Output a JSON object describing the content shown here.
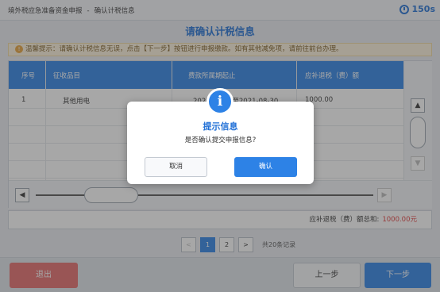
{
  "header": {
    "breadcrumb_parent": "境外税应急准备资金申报",
    "breadcrumb_sep": "-",
    "breadcrumb_current": "确认计税信息",
    "timer": "150s"
  },
  "page_title": "请确认计税信息",
  "notice": {
    "text": "温馨提示：请确认计税信息无误，点击【下一步】按钮进行申报缴款。如有其他减免项，请前往前台办理。"
  },
  "table": {
    "columns": [
      "序号",
      "征收品目",
      "费款所属期起止",
      "应补退税（费）额"
    ],
    "rows": [
      [
        "1",
        "其他用电",
        "2021-08-01至2021-08-30",
        "1000.00"
      ]
    ]
  },
  "total": {
    "label": "应补退税（费）额总和:",
    "amount": "1000.00元"
  },
  "pager": {
    "prev": "<",
    "pages": [
      "1",
      "2"
    ],
    "next": ">",
    "count": "共20条记录"
  },
  "footer": {
    "exit": "退出",
    "prev": "上一步",
    "next": "下一步"
  },
  "dialog": {
    "icon": "i",
    "title": "提示信息",
    "message": "是否确认提交申报信息?",
    "cancel": "取消",
    "confirm": "确认"
  },
  "colors": {
    "accent": "#2d82e6",
    "danger": "#e56a6a",
    "amount": "#e23b3b"
  }
}
